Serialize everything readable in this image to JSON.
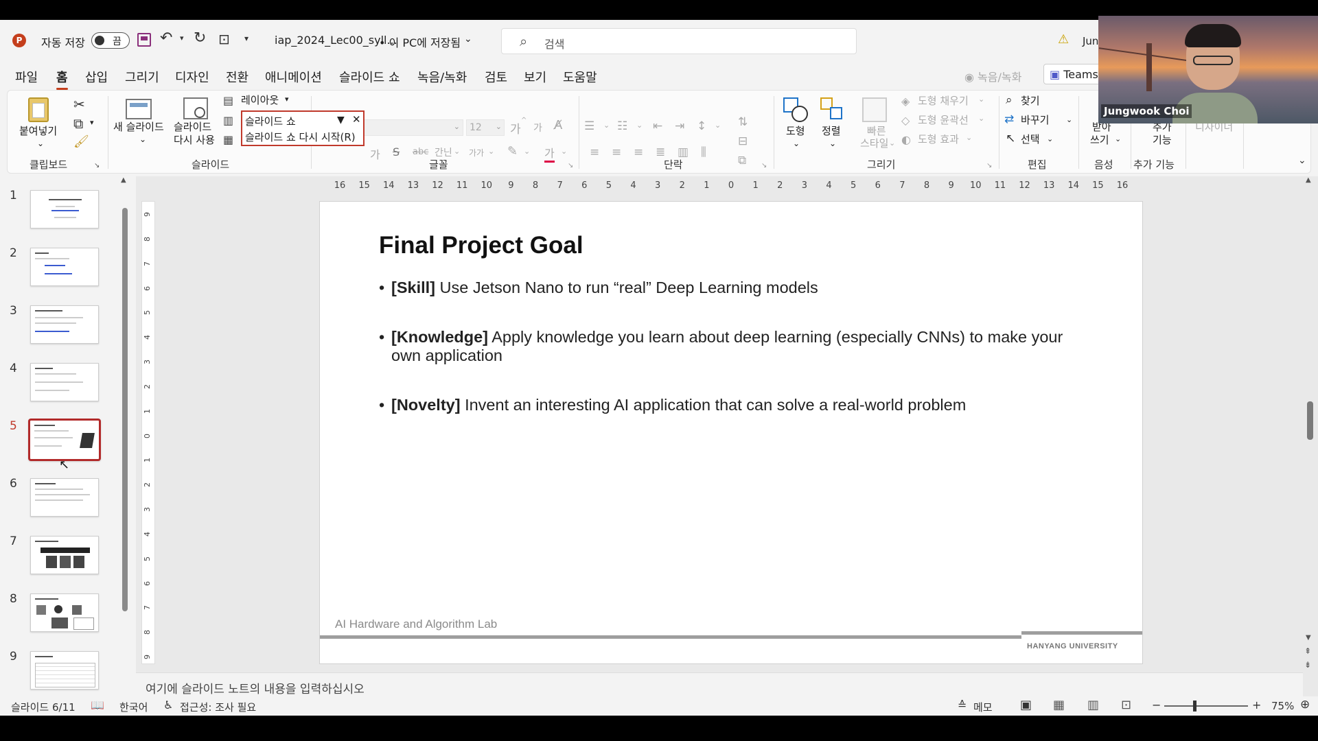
{
  "titlebar": {
    "autosave_label": "자동 저장",
    "autosave_state": "끔",
    "filename": "iap_2024_Lec00_syll...",
    "save_location": "• 이 PC에 저장됨",
    "search_placeholder": "검색",
    "user_partial": "Jun"
  },
  "tabs": [
    "파일",
    "홈",
    "삽입",
    "그리기",
    "디자인",
    "전환",
    "애니메이션",
    "슬라이드 쇼",
    "녹음/녹화",
    "검토",
    "보기",
    "도움말"
  ],
  "active_tab": "홈",
  "record_button": "녹음/녹화",
  "teams_button": "Teams",
  "ribbon": {
    "clipboard": {
      "paste": "붙여넣기",
      "group": "클립보드"
    },
    "slides": {
      "new_slide": "새 슬라이드",
      "reuse_line1": "슬라이드",
      "reuse_line2": "다시 사용",
      "layout": "레이아웃",
      "group": "슬라이드"
    },
    "font": {
      "size": "12",
      "group": "글꼴",
      "ga_big": "가",
      "ga_small": "가",
      "strike": "S",
      "abc": "abc",
      "spacing": "간닌",
      "case": "가가",
      "color_a": "가"
    },
    "paragraph": {
      "group": "단락"
    },
    "drawing": {
      "shape": "도형",
      "arrange": "정렬",
      "quick_line1": "빠른",
      "quick_line2": "스타일",
      "fill": "도형 채우기",
      "outline": "도형 윤곽선",
      "effects": "도형 효과",
      "group": "그리기"
    },
    "editing": {
      "find": "찾기",
      "replace": "바꾸기",
      "select": "선택",
      "group": "편집"
    },
    "voice": {
      "dictate_line1": "받아",
      "dictate_line2": "쓰기",
      "group": "음성"
    },
    "addins": {
      "line1": "추가",
      "line2": "기능",
      "group": "추가 기능"
    },
    "designer": "디자이너"
  },
  "dropdown_popup": {
    "item1": "슬라이드 쇼",
    "item2": "슬라이드 쇼 다시 시작(R)"
  },
  "hruler": [
    "16",
    "15",
    "14",
    "13",
    "12",
    "11",
    "10",
    "9",
    "8",
    "7",
    "6",
    "5",
    "4",
    "3",
    "2",
    "1",
    "0",
    "1",
    "2",
    "3",
    "4",
    "5",
    "6",
    "7",
    "8",
    "9",
    "10",
    "11",
    "12",
    "13",
    "14",
    "15",
    "16"
  ],
  "vruler": [
    "9",
    "8",
    "7",
    "6",
    "5",
    "4",
    "3",
    "2",
    "1",
    "0",
    "1",
    "2",
    "3",
    "4",
    "5",
    "6",
    "7",
    "8",
    "9"
  ],
  "thumbnails": [
    "1",
    "2",
    "3",
    "4",
    "5",
    "6",
    "7",
    "8",
    "9"
  ],
  "selected_thumbnail": "5",
  "slide": {
    "title": "Final Project Goal",
    "bullets": [
      {
        "bold": "[Skill]",
        "text": " Use Jetson Nano to run “real” Deep Learning models"
      },
      {
        "bold": "[Knowledge]",
        "text": " Apply knowledge you learn about deep learning (especially CNNs) to make your own application"
      },
      {
        "bold": "[Novelty]",
        "text": " Invent an interesting AI application that can solve a real-world problem"
      }
    ],
    "footer_left": "AI Hardware and Algorithm Lab",
    "footer_right": "HANYANG UNIVERSITY"
  },
  "notes_placeholder": "여기에 슬라이드 노트의 내용을 입력하십시오",
  "status": {
    "slide_info": "슬라이드 6/11",
    "language": "한국어",
    "accessibility": "접근성: 조사 필요",
    "notes": "메모",
    "zoom": "75%"
  },
  "webcam": {
    "name": "Jungwook Choi"
  },
  "colors": {
    "accent": "#c43e1c",
    "selection": "#c0392b",
    "app_bg": "#f3f3f3"
  }
}
